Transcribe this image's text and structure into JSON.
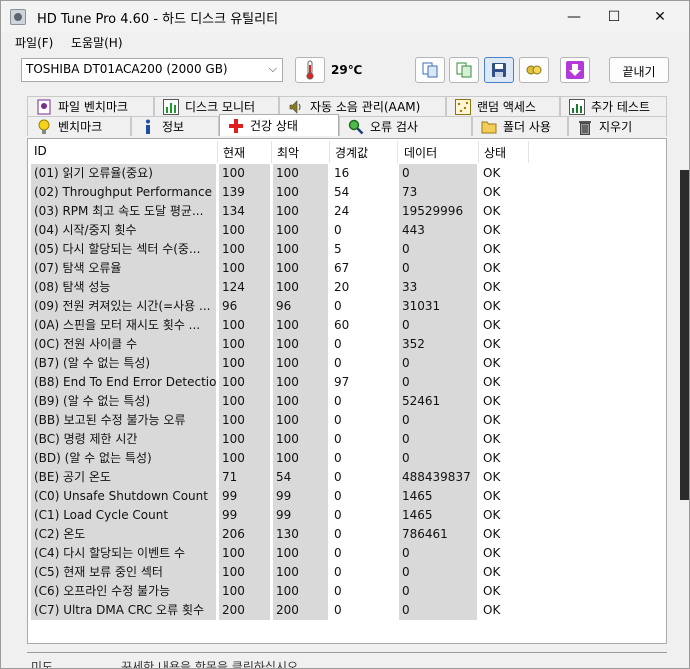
{
  "window": {
    "title": "HD Tune Pro 4.60 - 하드 디스크 유틸리티",
    "minimize": "—",
    "maximize": "☐",
    "close": "✕"
  },
  "menu": [
    "파일(F)",
    "도움말(H)"
  ],
  "toolbar": {
    "drive": "TOSHIBA DT01ACA200 (2000 GB)",
    "temperature": "29℃",
    "exit_label": "끝내기"
  },
  "tabs_top": [
    "파일 벤치마크",
    "디스크 모니터",
    "자동 소음 관리(AAM)",
    "랜덤 액세스",
    "추가 테스트"
  ],
  "tabs_bottom": [
    "벤치마크",
    "정보",
    "건강 상태",
    "오류 검사",
    "폴더 사용",
    "지우기"
  ],
  "active_tab": "건강 상태",
  "table": {
    "headers": [
      "ID",
      "현재",
      "최악",
      "경계값",
      "데이터",
      "상태"
    ],
    "rows": [
      [
        "(01) 읽기 오류율(중요)",
        "100",
        "100",
        "16",
        "0",
        "OK"
      ],
      [
        "(02) Throughput Performance",
        "139",
        "100",
        "54",
        "73",
        "OK"
      ],
      [
        "(03) RPM 최고 속도 도달 평균...",
        "134",
        "100",
        "24",
        "19529996",
        "OK"
      ],
      [
        "(04) 시작/중지 횟수",
        "100",
        "100",
        "0",
        "443",
        "OK"
      ],
      [
        "(05) 다시 할당되는 섹터 수(중...",
        "100",
        "100",
        "5",
        "0",
        "OK"
      ],
      [
        "(07) 탐색 오류율",
        "100",
        "100",
        "67",
        "0",
        "OK"
      ],
      [
        "(08) 탐색 성능",
        "124",
        "100",
        "20",
        "33",
        "OK"
      ],
      [
        "(09) 전원 켜져있는 시간(=사용 ...",
        "96",
        "96",
        "0",
        "31031",
        "OK"
      ],
      [
        "(0A) 스핀을 모터 재시도 횟수 ...",
        "100",
        "100",
        "60",
        "0",
        "OK"
      ],
      [
        "(0C) 전원 사이클 수",
        "100",
        "100",
        "0",
        "352",
        "OK"
      ],
      [
        "(B7) (알 수 없는 특성)",
        "100",
        "100",
        "0",
        "0",
        "OK"
      ],
      [
        "(B8) End To End Error Detection...",
        "100",
        "100",
        "97",
        "0",
        "OK"
      ],
      [
        "(B9) (알 수 없는 특성)",
        "100",
        "100",
        "0",
        "52461",
        "OK"
      ],
      [
        "(BB) 보고된 수정 불가능 오류",
        "100",
        "100",
        "0",
        "0",
        "OK"
      ],
      [
        "(BC) 명령 제한 시간",
        "100",
        "100",
        "0",
        "0",
        "OK"
      ],
      [
        "(BD) (알 수 없는 특성)",
        "100",
        "100",
        "0",
        "0",
        "OK"
      ],
      [
        "(BE) 공기 온도",
        "71",
        "54",
        "0",
        "488439837",
        "OK"
      ],
      [
        "(C0) Unsafe Shutdown Count",
        "99",
        "99",
        "0",
        "1465",
        "OK"
      ],
      [
        "(C1) Load Cycle Count",
        "99",
        "99",
        "0",
        "1465",
        "OK"
      ],
      [
        "(C2) 온도",
        "206",
        "130",
        "0",
        "786461",
        "OK"
      ],
      [
        "(C4) 다시 할당되는 이벤트 수",
        "100",
        "100",
        "0",
        "0",
        "OK"
      ],
      [
        "(C5) 현재 보류 중인 섹터",
        "100",
        "100",
        "0",
        "0",
        "OK"
      ],
      [
        "(C6) 오프라인 수정 불가능",
        "100",
        "100",
        "0",
        "0",
        "OK"
      ],
      [
        "(C7) Ultra DMA CRC 오류 횟수",
        "200",
        "200",
        "0",
        "0",
        "OK"
      ]
    ]
  },
  "status_bar": [
    "미도",
    "꾸세한 내용을 항목을 클릭하십시오"
  ]
}
